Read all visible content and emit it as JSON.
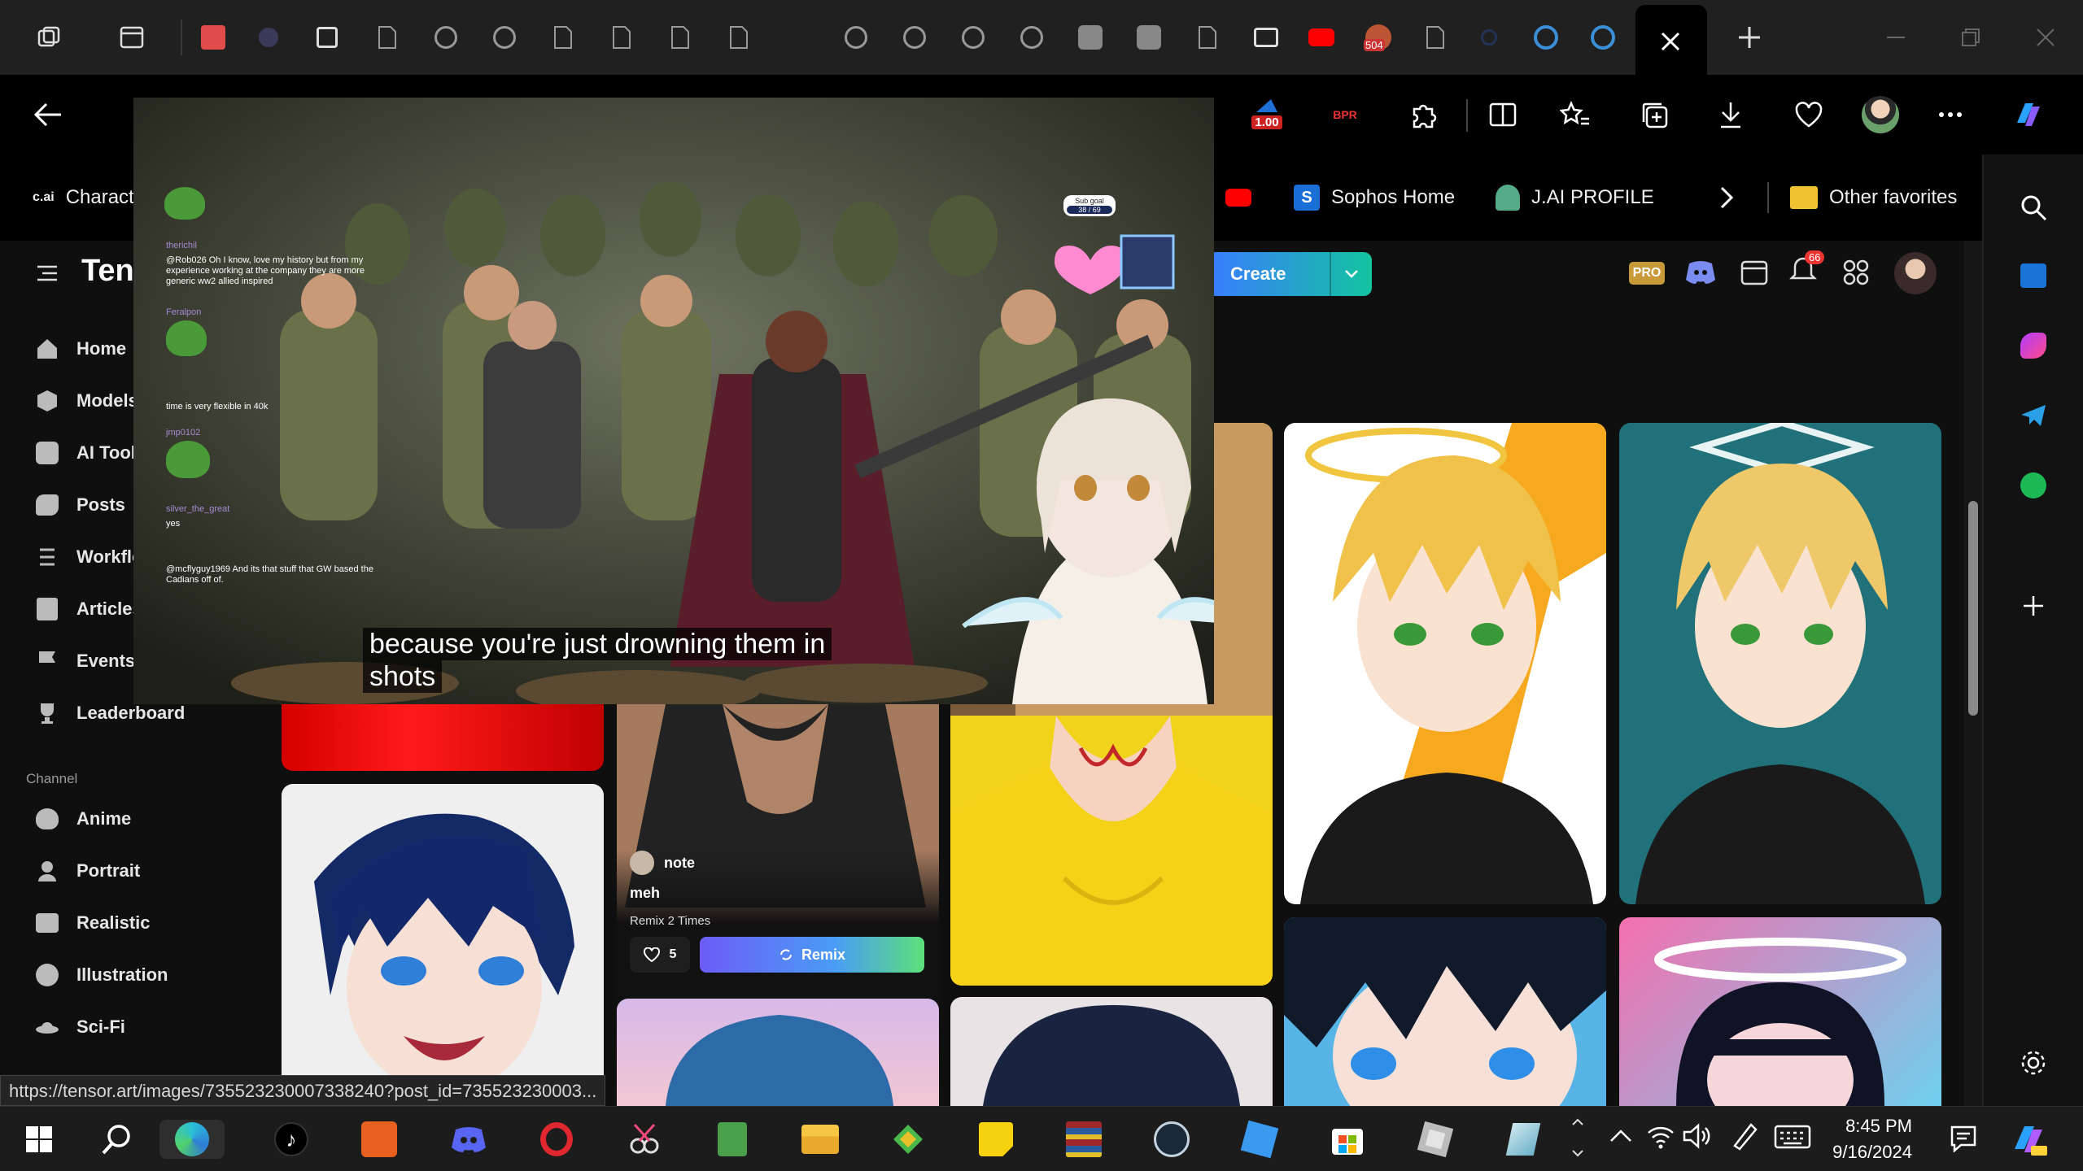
{
  "status_url": "https://tensor.art/images/735523230007338240?post_id=735523230003...",
  "toolbar": {
    "badge_value": "1.00"
  },
  "favorites": [
    {
      "label": "Charact",
      "icon": "cai-icon"
    },
    {
      "label": "Sophos Home",
      "icon": "sophos-icon"
    },
    {
      "label": "J.AI PROFILE",
      "icon": "jai-icon"
    },
    {
      "label": "Other favorites",
      "icon": "folder-icon"
    }
  ],
  "site": {
    "logo_text": "Ten",
    "create_label": "Create",
    "pro_label": "PRO",
    "notifications_count": "66",
    "nav": [
      {
        "label": "Home",
        "icon": "home-icon"
      },
      {
        "label": "Models",
        "icon": "cube-icon"
      },
      {
        "label": "AI Tools",
        "icon": "ai-tools-icon"
      },
      {
        "label": "Posts",
        "icon": "posts-icon"
      },
      {
        "label": "Workflo",
        "icon": "workflow-icon"
      },
      {
        "label": "Articles",
        "icon": "articles-icon"
      },
      {
        "label": "Events",
        "icon": "flag-icon"
      },
      {
        "label": "Leaderboard",
        "icon": "trophy-icon"
      }
    ],
    "channel_heading": "Channel",
    "channels": [
      {
        "label": "Anime",
        "icon": "cat-icon"
      },
      {
        "label": "Portrait",
        "icon": "portrait-icon"
      },
      {
        "label": "Realistic",
        "icon": "camera-icon"
      },
      {
        "label": "Illustration",
        "icon": "palette-icon"
      },
      {
        "label": "Sci-Fi",
        "icon": "ufo-icon"
      }
    ],
    "post": {
      "author": "note",
      "title": "meh",
      "remix_count": "Remix 2 Times",
      "likes": "5",
      "remix_label": "Remix"
    }
  },
  "video": {
    "captions": [
      "because you're just drowning them in",
      "shots"
    ],
    "sub_goal_label": "Sub goal",
    "sub_goal_value": "38 / 69",
    "chat": [
      {
        "name": "therichil",
        "text": "@Rob026 Oh I know, love my history but from my experience working at the company they are more generic ww2 allied inspired"
      },
      {
        "name": "Feralpon",
        "text": ""
      },
      {
        "name": "",
        "text": "time is very flexible in 40k"
      },
      {
        "name": "jmp0102",
        "text": ""
      },
      {
        "name": "silver_the_great",
        "text": "yes"
      },
      {
        "name": "",
        "text": "@mcflyguy1969 And its that stuff that GW based the Cadians off of."
      }
    ]
  },
  "taskbar": {
    "time": "8:45 PM",
    "date": "9/16/2024"
  },
  "tabs": {
    "count_badge": "504"
  }
}
